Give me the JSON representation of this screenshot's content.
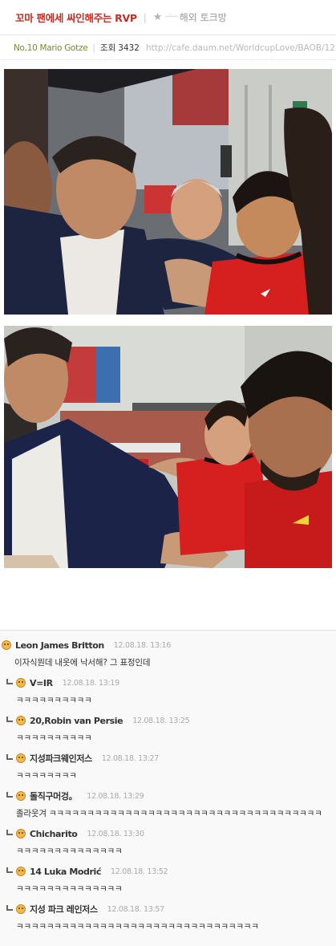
{
  "post": {
    "title": "꼬마 팬에세 싸인해주는 RVP",
    "separator": "|",
    "board_dots": "·······",
    "board": "해외 토크방",
    "author": "No,10 Mario Gotze",
    "views_label": "조회",
    "views": "3432",
    "url": "http://cafe.daum.net/WorldcupLove/BAOB/1282291"
  },
  "comments": [
    {
      "nick": "Leon James Britton",
      "date": "12.08.18. 13:16",
      "text": "이자식뭔데 내옷에 낙서해? 그 표정인데",
      "reply": false
    },
    {
      "nick": "V=IR",
      "date": "12.08.18. 13:19",
      "text": "ㅋㅋㅋㅋㅋㅋㅋㅋㅋㅋ",
      "reply": true
    },
    {
      "nick": "20,Robin van Persie",
      "date": "12.08.18. 13:25",
      "text": "ㅋㅋㅋㅋㅋㅋㅋㅋㅋㅋ",
      "reply": true
    },
    {
      "nick": "지성파크웨인저스",
      "date": "12.08.18. 13:27",
      "text": "ㅋㅋㅋㅋㅋㅋㅋㅋ",
      "reply": true
    },
    {
      "nick": "돌직구머겅。",
      "date": "12.08.18. 13:29",
      "text": "졸라웃겨 ㅋㅋㅋㅋㅋㅋㅋㅋㅋㅋㅋㅋㅋㅋㅋㅋㅋㅋㅋㅋㅋㅋㅋㅋㅋㅋㅋㅋㅋㅋㅋㅋㅋㅋㅋㅋ",
      "reply": true
    },
    {
      "nick": "Chicharito",
      "date": "12.08.18. 13:30",
      "text": "ㅋㅋㅋㅋㅋㅋㅋㅋㅋㅋㅋㅋㅋㅋ",
      "reply": true
    },
    {
      "nick": "14 Luka Modrić",
      "date": "12.08.18. 13:52",
      "text": "ㅋㅋㅋㅋㅋㅋㅋㅋㅋㅋㅋㅋㅋㅋ",
      "reply": true
    },
    {
      "nick": "지성 파크 레인저스",
      "date": "12.08.18. 13:57",
      "text": "ㅋㅋㅋㅋㅋㅋㅋㅋㅋㅋㅋㅋㅋㅋㅋㅋㅋㅋㅋㅋㅋㅋㅋㅋㅋㅋㅋㅋㅋㅋㅋㅋ",
      "reply": true
    }
  ]
}
